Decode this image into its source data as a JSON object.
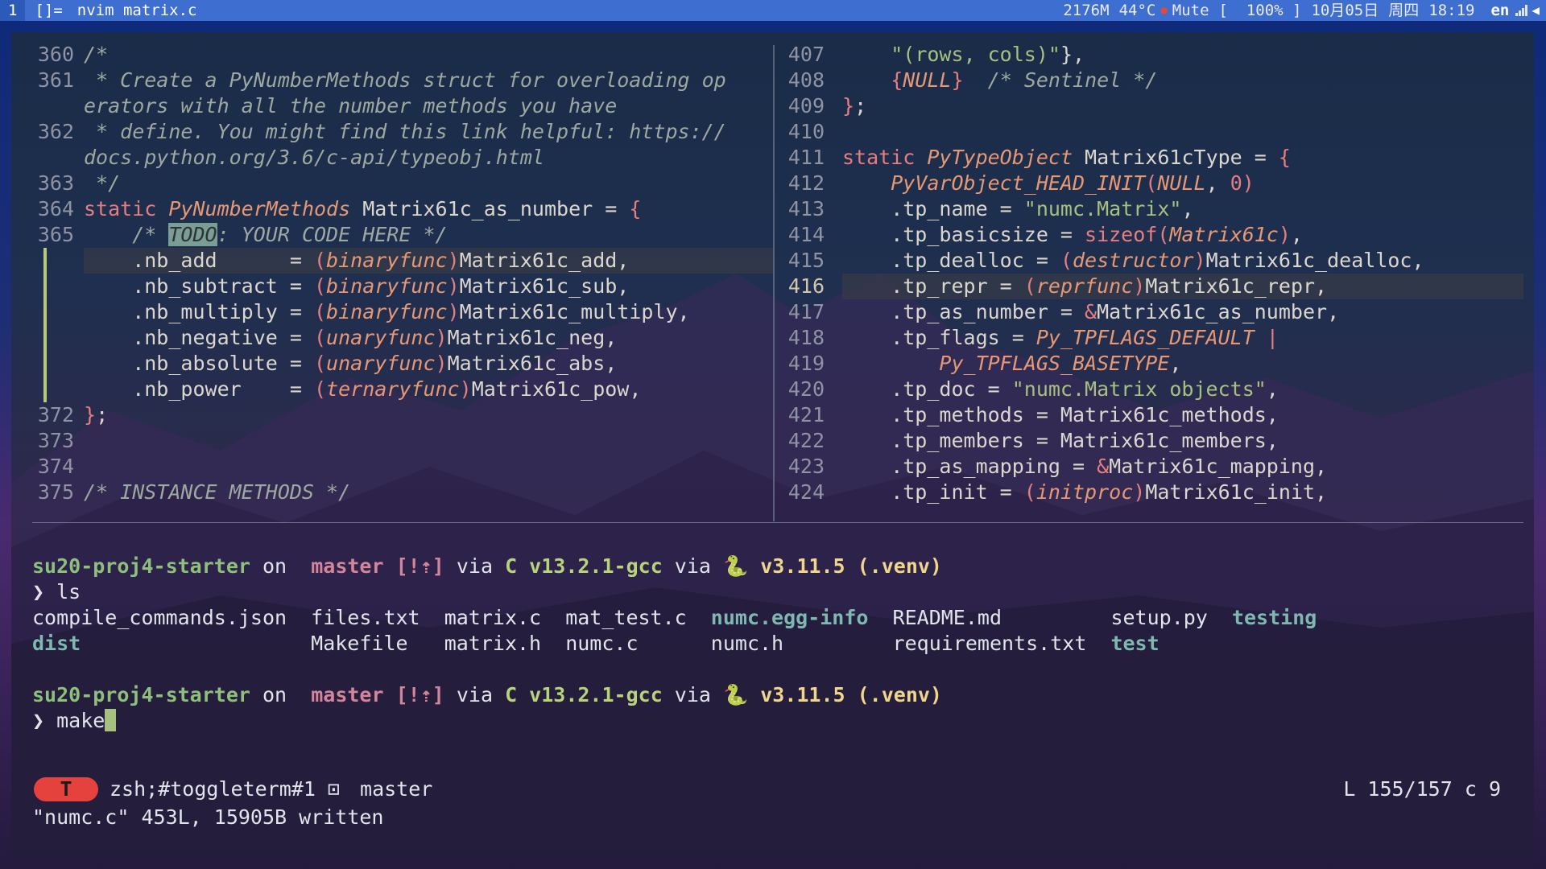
{
  "topbar": {
    "workspace": "1",
    "layout": "[]=",
    "window_title": "nvim matrix.c",
    "memory": "2176M",
    "temperature": "44°C",
    "mute_label": "Mute",
    "battery": "[  100% ]",
    "date": "10月05日",
    "weekday": "周四",
    "time": "18:19",
    "lang": "en"
  },
  "left_pane": {
    "lines": [
      {
        "num": "360",
        "html": "<span class=\"cm\">/*</span>"
      },
      {
        "num": "361",
        "html": "<span class=\"cm\"> * Create a PyNumberMethods struct for overloading op</span>"
      },
      {
        "num": "",
        "html": "<span class=\"cm\">erators with all the number methods you have</span>"
      },
      {
        "num": "362",
        "html": "<span class=\"cm\"> * define. You might find this link helpful: https://</span>"
      },
      {
        "num": "",
        "html": "<span class=\"cm\">docs.python.org/3.6/c-api/typeobj.html</span>"
      },
      {
        "num": "363",
        "html": "<span class=\"cm\"> */</span>"
      },
      {
        "num": "364",
        "html": "<span class=\"kw\">static</span> <span class=\"ty\">PyNumberMethods</span> Matrix61c_as_number = <span class=\"kw\">{</span>"
      },
      {
        "num": "365",
        "html": "    <span class=\"cm\">/* <span class=\"todo\">TODO</span>: YOUR CODE HERE */</span>"
      },
      {
        "num": "",
        "html": "    .nb_add      = <span class=\"kw\">(</span><span class=\"ty\">binaryfunc</span><span class=\"kw\">)</span>Matrix61c_add,",
        "hl": true,
        "git": true
      },
      {
        "num": "",
        "html": "    .nb_subtract = <span class=\"kw\">(</span><span class=\"ty\">binaryfunc</span><span class=\"kw\">)</span>Matrix61c_sub,",
        "git": true
      },
      {
        "num": "",
        "html": "    .nb_multiply = <span class=\"kw\">(</span><span class=\"ty\">binaryfunc</span><span class=\"kw\">)</span>Matrix61c_multiply,",
        "git": true
      },
      {
        "num": "",
        "html": "    .nb_negative = <span class=\"kw\">(</span><span class=\"ty\">unaryfunc</span><span class=\"kw\">)</span>Matrix61c_neg,",
        "git": true
      },
      {
        "num": "",
        "html": "    .nb_absolute = <span class=\"kw\">(</span><span class=\"ty\">unaryfunc</span><span class=\"kw\">)</span>Matrix61c_abs,",
        "git": true
      },
      {
        "num": "",
        "html": "    .nb_power    = <span class=\"kw\">(</span><span class=\"ty\">ternaryfunc</span><span class=\"kw\">)</span>Matrix61c_pow,",
        "git": true
      },
      {
        "num": "372",
        "html": "<span class=\"kw\">}</span>;"
      },
      {
        "num": "373",
        "html": ""
      },
      {
        "num": "374",
        "html": ""
      },
      {
        "num": "375",
        "html": "<span class=\"cm\">/* INSTANCE METHODS */</span>"
      }
    ]
  },
  "right_pane": {
    "lines": [
      {
        "num": "407",
        "html": "    <span class=\"st\">\"(rows, cols)\"</span>},"
      },
      {
        "num": "408",
        "html": "    <span class=\"kw\">{</span><span class=\"ty\">NULL</span><span class=\"kw\">}</span>  <span class=\"cm\">/* Sentinel */</span>"
      },
      {
        "num": "409",
        "html": "<span class=\"kw\">}</span>;"
      },
      {
        "num": "410",
        "html": ""
      },
      {
        "num": "411",
        "html": "<span class=\"kw\">static</span> <span class=\"ty\">PyTypeObject</span> Matrix61cType = <span class=\"kw\">{</span>"
      },
      {
        "num": "412",
        "html": "    <span class=\"ty\">PyVarObject_HEAD_INIT</span><span class=\"kw\">(</span><span class=\"ty\">NULL</span>, <span class=\"kw\">0)</span>"
      },
      {
        "num": "413",
        "html": "    .tp_name = <span class=\"st\">\"numc.Matrix\"</span>,"
      },
      {
        "num": "414",
        "html": "    .tp_basicsize = <span class=\"kw\">sizeof(</span><span class=\"ty\">Matrix61c</span><span class=\"kw\">)</span>,"
      },
      {
        "num": "415",
        "html": "    .tp_dealloc = <span class=\"kw\">(</span><span class=\"ty\">destructor</span><span class=\"kw\">)</span>Matrix61c_dealloc,"
      },
      {
        "num": "416",
        "html": "    .tp_repr = <span class=\"kw\">(</span><span class=\"ty\">reprfunc</span><span class=\"kw\">)</span>Matrix61c_repr,",
        "hl": true,
        "cur": true
      },
      {
        "num": "417",
        "html": "    .tp_as_number = <span class=\"kw\">&amp;</span>Matrix61c_as_number,"
      },
      {
        "num": "418",
        "html": "    .tp_flags = <span class=\"ty\">Py_TPFLAGS_DEFAULT</span> <span class=\"kw\">|</span>"
      },
      {
        "num": "419",
        "html": "        <span class=\"ty\">Py_TPFLAGS_BASETYPE</span>,"
      },
      {
        "num": "420",
        "html": "    .tp_doc = <span class=\"st\">\"numc.Matrix objects\"</span>,"
      },
      {
        "num": "421",
        "html": "    .tp_methods = Matrix61c_methods,"
      },
      {
        "num": "422",
        "html": "    .tp_members = Matrix61c_members,"
      },
      {
        "num": "423",
        "html": "    .tp_as_mapping = <span class=\"kw\">&amp;</span>Matrix61c_mapping,"
      },
      {
        "num": "424",
        "html": "    .tp_init = <span class=\"kw\">(</span><span class=\"ty\">initproc</span><span class=\"kw\">)</span>Matrix61c_init,"
      }
    ]
  },
  "terminal": {
    "prompt": {
      "dir": "su20-proj4-starter",
      "on": " on ",
      "branch_icon": "",
      "branch": "master",
      "status": "[!⇡]",
      "via": " via ",
      "c_lang": "C v13.2.1-gcc",
      "py_icon": "🐍",
      "python": "v3.11.5 (.venv)"
    },
    "prompt_char": "❯",
    "cmd1": "ls",
    "ls_row1": [
      {
        "name": "compile_commands.json",
        "col": 0,
        "dir": false
      },
      {
        "name": "files.txt",
        "col": 23,
        "dir": false
      },
      {
        "name": "matrix.c",
        "col": 34,
        "dir": false
      },
      {
        "name": "mat_test.c",
        "col": 44,
        "dir": false
      },
      {
        "name": "numc.egg-info",
        "col": 56,
        "dir": true
      },
      {
        "name": "README.md",
        "col": 71,
        "dir": false
      },
      {
        "name": "setup.py",
        "col": 89,
        "dir": false
      },
      {
        "name": "testing",
        "col": 99,
        "dir": true
      }
    ],
    "ls_row2": [
      {
        "name": "dist",
        "col": 0,
        "dir": true
      },
      {
        "name": "Makefile",
        "col": 23,
        "dir": false
      },
      {
        "name": "matrix.h",
        "col": 34,
        "dir": false
      },
      {
        "name": "numc.c",
        "col": 44,
        "dir": false
      },
      {
        "name": "numc.h",
        "col": 56,
        "dir": false
      },
      {
        "name": "requirements.txt",
        "col": 71,
        "dir": false
      },
      {
        "name": "test",
        "col": 89,
        "dir": true
      }
    ],
    "cmd2": "make"
  },
  "statusline": {
    "mode_badge": "T",
    "term_name": "zsh;#toggleterm#1",
    "branch_icon": "",
    "branch": "master",
    "position": "L 155/157 c 9"
  },
  "message": "\"numc.c\" 453L, 15905B written"
}
